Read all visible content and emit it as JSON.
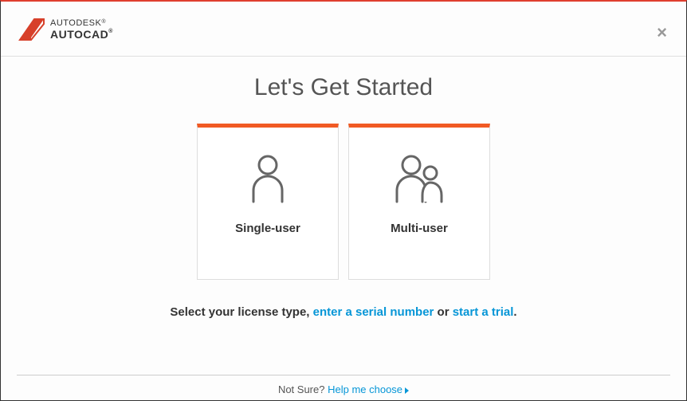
{
  "brand": {
    "line1_pre": "AUTODESK",
    "line2_pre": "AUTOCAD",
    "reg": "®"
  },
  "close_glyph": "×",
  "main": {
    "title": "Let's Get Started",
    "cards": [
      {
        "label": "Single-user"
      },
      {
        "label": "Multi-user"
      }
    ],
    "instruction": {
      "prefix": "Select your license type, ",
      "link1": "enter a serial number",
      "middle": " or ",
      "link2": "start a trial",
      "suffix": "."
    }
  },
  "footer": {
    "question": "Not Sure? ",
    "link": "Help me choose"
  }
}
